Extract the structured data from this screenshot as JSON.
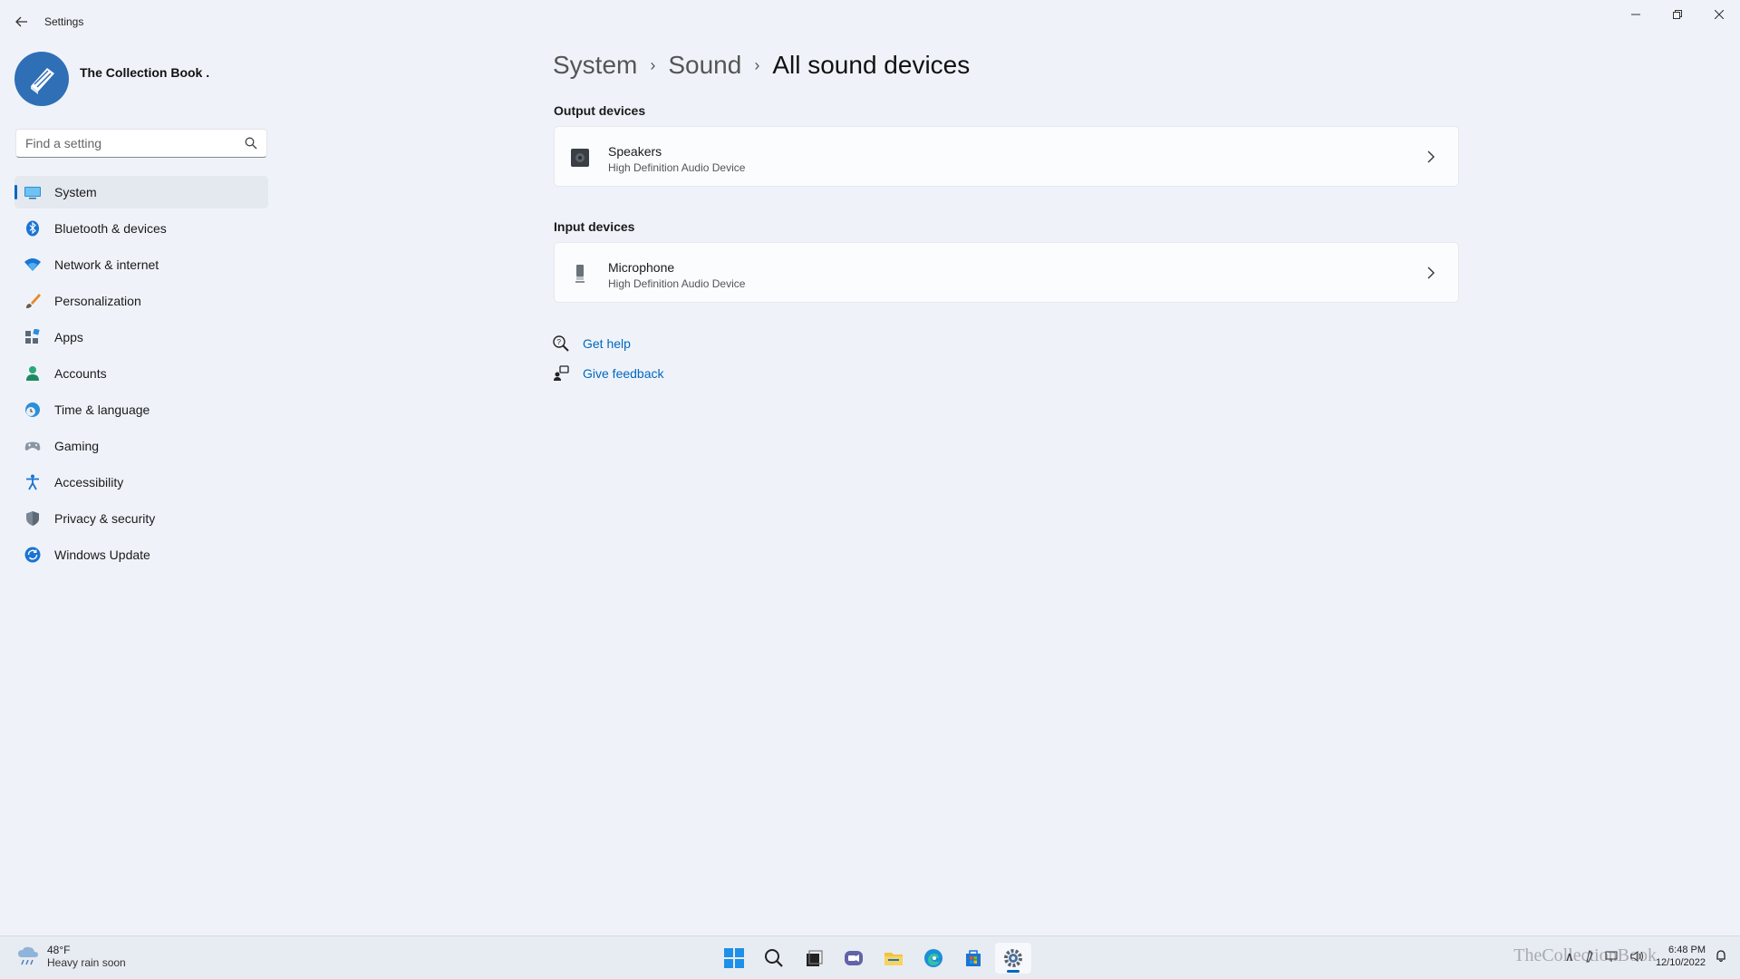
{
  "window": {
    "title": "Settings"
  },
  "profile": {
    "name": "The Collection Book ."
  },
  "search": {
    "placeholder": "Find a setting"
  },
  "nav": {
    "items": [
      {
        "label": "System",
        "icon": "monitor-icon",
        "active": true
      },
      {
        "label": "Bluetooth & devices",
        "icon": "bluetooth-icon"
      },
      {
        "label": "Network & internet",
        "icon": "wifi-icon"
      },
      {
        "label": "Personalization",
        "icon": "brush-icon"
      },
      {
        "label": "Apps",
        "icon": "apps-icon"
      },
      {
        "label": "Accounts",
        "icon": "person-icon"
      },
      {
        "label": "Time & language",
        "icon": "globe-clock-icon"
      },
      {
        "label": "Gaming",
        "icon": "gamepad-icon"
      },
      {
        "label": "Accessibility",
        "icon": "accessibility-icon"
      },
      {
        "label": "Privacy & security",
        "icon": "shield-icon"
      },
      {
        "label": "Windows Update",
        "icon": "update-icon"
      }
    ]
  },
  "breadcrumb": {
    "items": [
      "System",
      "Sound",
      "All sound devices"
    ]
  },
  "output": {
    "label": "Output devices",
    "device": {
      "name": "Speakers",
      "sub": "High Definition Audio Device",
      "icon": "speaker-icon"
    }
  },
  "input": {
    "label": "Input devices",
    "device": {
      "name": "Microphone",
      "sub": "High Definition Audio Device",
      "icon": "microphone-icon"
    }
  },
  "links": {
    "help": "Get help",
    "feedback": "Give feedback"
  },
  "taskbar": {
    "weather": {
      "temp": "48°F",
      "condition": "Heavy rain soon"
    },
    "clock": {
      "time": "6:48 PM",
      "date": "12/10/2022"
    },
    "watermark": "TheCollectionBook",
    "apps": [
      "start-icon",
      "search-icon",
      "task-view-icon",
      "chat-icon",
      "file-explorer-icon",
      "edge-icon",
      "store-icon",
      "settings-icon"
    ]
  },
  "colors": {
    "accent": "#0067c0",
    "background": "#eff3f9",
    "card": "#fbfcfe"
  }
}
